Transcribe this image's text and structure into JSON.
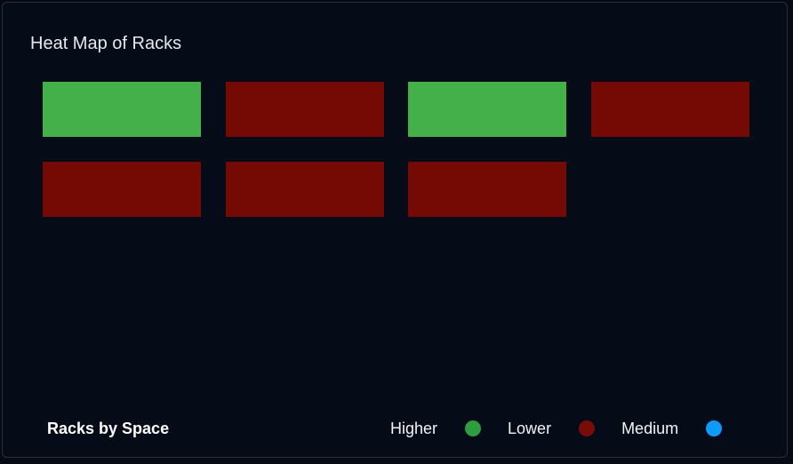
{
  "panel": {
    "title": "Heat Map of Racks"
  },
  "racks": [
    {
      "level": "Higher",
      "color": "#43b04a"
    },
    {
      "level": "Lower",
      "color": "#750a05"
    },
    {
      "level": "Higher",
      "color": "#43b04a"
    },
    {
      "level": "Lower",
      "color": "#750a05"
    },
    {
      "level": "Lower",
      "color": "#750a05"
    },
    {
      "level": "Lower",
      "color": "#750a05"
    },
    {
      "level": "Lower",
      "color": "#750a05"
    }
  ],
  "footer": {
    "title": "Racks by Space"
  },
  "legend": [
    {
      "label": "Higher",
      "color": "#2e9d3f"
    },
    {
      "label": "Lower",
      "color": "#7a0c07"
    },
    {
      "label": "Medium",
      "color": "#0c9cff"
    }
  ]
}
